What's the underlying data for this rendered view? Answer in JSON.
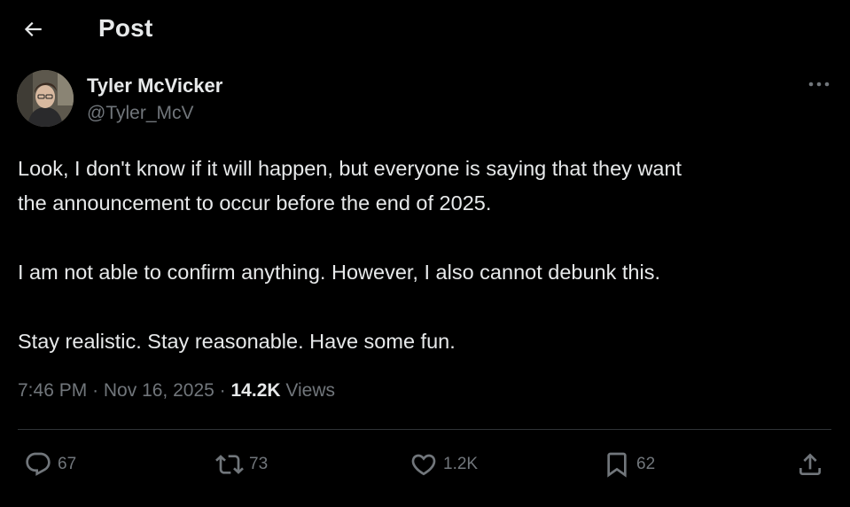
{
  "header": {
    "title": "Post"
  },
  "author": {
    "name": "Tyler McVicker",
    "handle": "@Tyler_McV"
  },
  "post": {
    "paragraphs": [
      "Look, I don't know if it will happen, but everyone is saying that they want",
      "the announcement to occur before the end of 2025.",
      "I am not able to confirm anything. However, I also cannot debunk this.",
      "Stay realistic. Stay reasonable. Have some fun."
    ],
    "time": "7:46 PM",
    "date": "Nov 16, 2025",
    "views_count": "14.2K",
    "views_label": "Views"
  },
  "actions": {
    "replies": "67",
    "reposts": "73",
    "likes": "1.2K",
    "bookmarks": "62"
  },
  "icons": [
    "back-arrow-icon",
    "more-icon",
    "reply-icon",
    "repost-icon",
    "like-icon",
    "bookmark-icon",
    "share-icon"
  ],
  "colors": {
    "background": "#000000",
    "text": "#e7e9ea",
    "secondary": "#71767b",
    "divider": "#2f3336"
  }
}
